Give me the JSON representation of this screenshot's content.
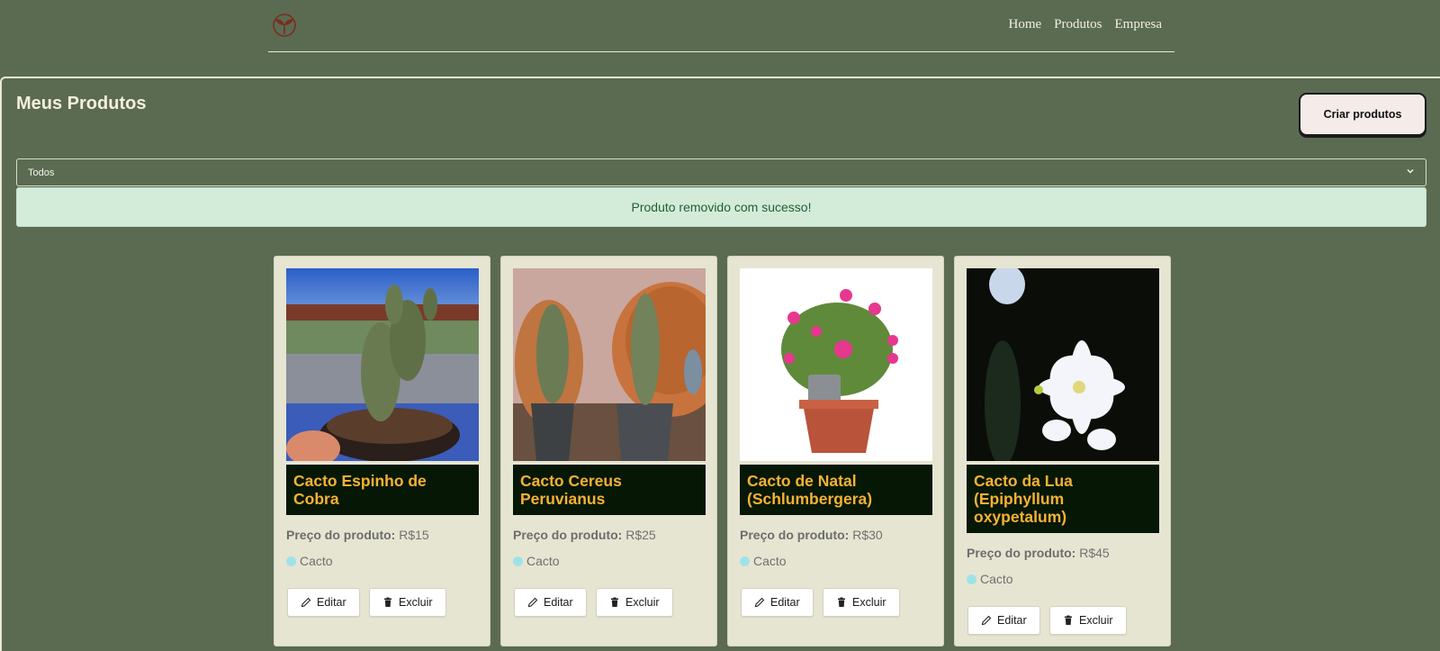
{
  "nav": {
    "links": [
      "Home",
      "Produtos",
      "Empresa"
    ]
  },
  "page": {
    "title": "Meus Produtos",
    "create_button": "Criar produtos",
    "filter_selected": "Todos",
    "alert": "Produto removido com sucesso!"
  },
  "labels": {
    "price": "Preço do produto:",
    "edit": "Editar",
    "delete": "Excluir"
  },
  "products": [
    {
      "name": "Cacto Espinho de Cobra",
      "price": "R$15",
      "category": "Cacto"
    },
    {
      "name": "Cacto Cereus Peruvianus",
      "price": "R$25",
      "category": "Cacto"
    },
    {
      "name": "Cacto de Natal (Schlumbergera)",
      "price": "R$30",
      "category": "Cacto"
    },
    {
      "name": "Cacto da Lua (Epiphyllum oxypetalum)",
      "price": "R$45",
      "category": "Cacto"
    }
  ],
  "colors": {
    "background": "#5a6b52",
    "card": "#e6e5d2",
    "name_bar": "#061706",
    "name_text": "#f6b234",
    "category_dot": "#9fe3e8",
    "alert_bg": "#d3ecda"
  }
}
